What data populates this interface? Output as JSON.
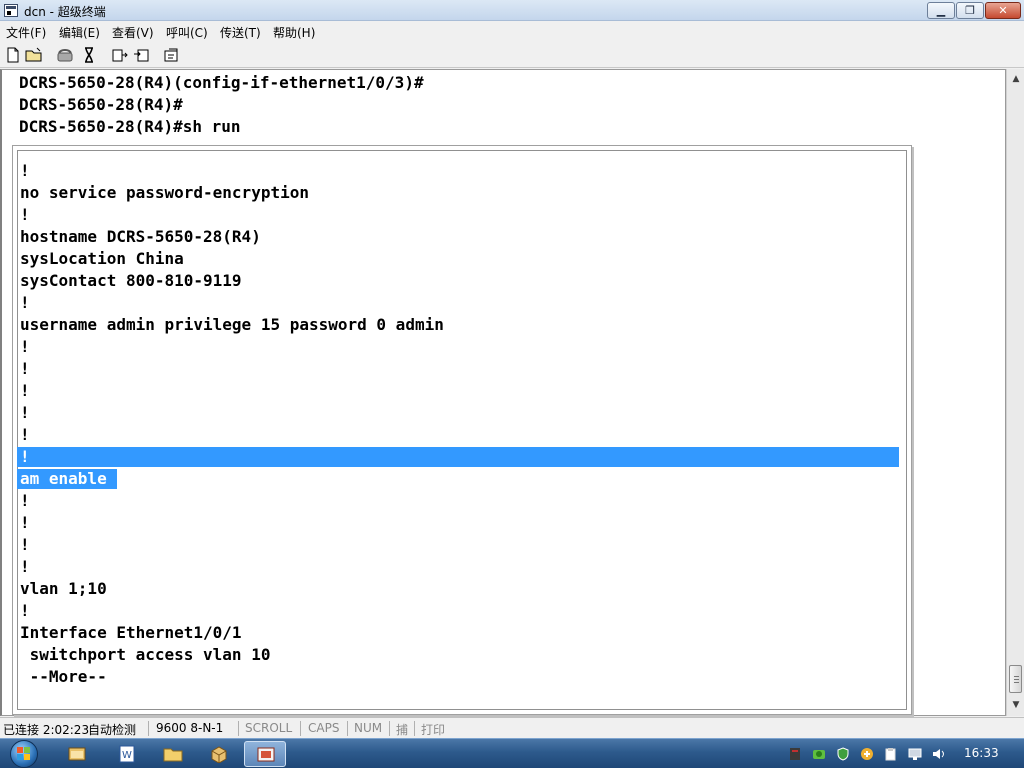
{
  "window": {
    "title": "dcn - 超级终端",
    "min_label": "▁",
    "max_label": "❐",
    "close_label": "✕"
  },
  "menu": {
    "items": [
      "文件(F)",
      "编辑(E)",
      "查看(V)",
      "呼叫(C)",
      "传送(T)",
      "帮助(H)"
    ]
  },
  "toolbar": {
    "icons": [
      "new-file-icon",
      "open-folder-icon",
      "phone-icon",
      "disconnect-icon",
      "send-icon",
      "receive-icon",
      "properties-icon"
    ]
  },
  "terminal": {
    "top_lines": [
      "DCRS-5650-28(R4)(config-if-ethernet1/0/3)#",
      "DCRS-5650-28(R4)#",
      "DCRS-5650-28(R4)#sh run"
    ],
    "inner_lines": [
      "!",
      "no service password-encryption",
      "!",
      "hostname DCRS-5650-28(R4)",
      "sysLocation China",
      "sysContact 800-810-9119",
      "!",
      "username admin privilege 15 password 0 admin",
      "!",
      "!",
      "!",
      "!",
      "!",
      "!",
      "am enable",
      "!",
      "!",
      "!",
      "!",
      "vlan 1;10",
      "!",
      "Interface Ethernet1/0/1",
      " switchport access vlan 10",
      " --More--"
    ]
  },
  "statusbar": {
    "connected": "已连接 2:02:23",
    "detect": "自动检测",
    "baud": "9600 8-N-1",
    "scroll": "SCROLL",
    "caps": "CAPS",
    "num": "NUM",
    "capture": "捕",
    "print": "打印"
  },
  "taskbar": {
    "clock": "16:33",
    "apps": [
      "explorer-icon",
      "word-icon",
      "folder-icon",
      "package-icon",
      "hyperterminal-icon"
    ]
  },
  "colors": {
    "selection": "#3399ff",
    "taskbar": "#2d5a8c"
  }
}
